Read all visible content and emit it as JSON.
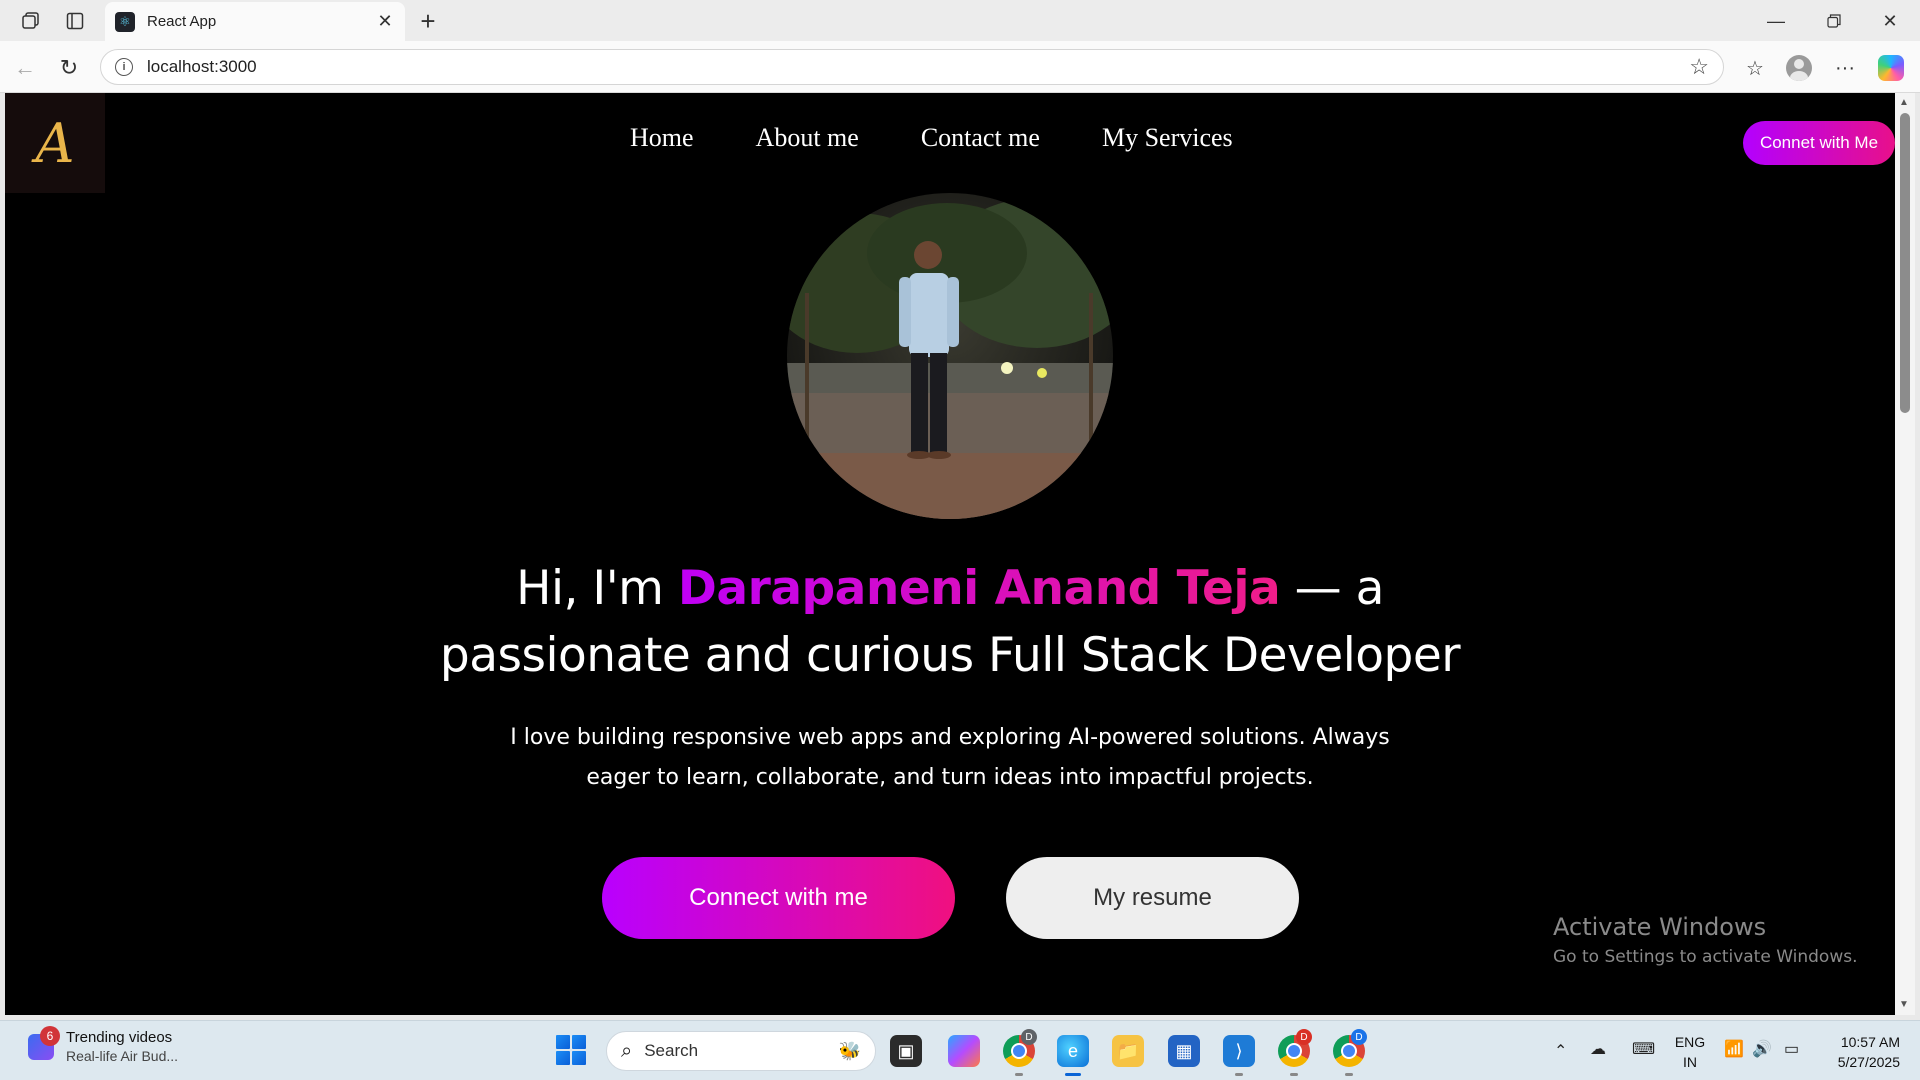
{
  "browser": {
    "tab_title": "React App",
    "url": "localhost:3000"
  },
  "site": {
    "logo_letter": "A",
    "nav": [
      "Home",
      "About me",
      "Contact me",
      "My Services"
    ],
    "header_button": "Connet with Me",
    "headline_prefix": "Hi, I'm ",
    "headline_name": "Darapaneni Anand Teja",
    "headline_suffix": " — a",
    "headline_line2": "passionate and curious Full Stack Developer",
    "subtitle_line1": "I love building responsive web apps and exploring AI-powered solutions. Always",
    "subtitle_line2": "eager to learn, collaborate, and turn ideas into impactful projects.",
    "primary_button": "Connect with me",
    "secondary_button": "My resume"
  },
  "watermark": {
    "line1": "Activate Windows",
    "line2": "Go to Settings to activate Windows."
  },
  "taskbar": {
    "news_badge": "6",
    "news_title": "Trending videos",
    "news_subtitle": "Real-life Air Bud...",
    "search_placeholder": "Search",
    "chrome_badge_1": "D",
    "chrome_badge_2": "D",
    "chrome_badge_3": "D",
    "lang_top": "ENG",
    "lang_bottom": "IN",
    "time": "10:57 AM",
    "date": "5/27/2025"
  },
  "colors": {
    "accent_gradient_start": "#b900ff",
    "accent_gradient_end": "#f0107f",
    "page_background": "#000000"
  },
  "icons": {
    "tab_favicon": "react-icon",
    "back": "back-arrow-icon",
    "refresh": "refresh-icon",
    "info": "info-icon",
    "favorite": "star-icon",
    "favorites_list": "favorites-icon",
    "profile": "profile-icon",
    "more": "more-icon",
    "copilot": "copilot-icon"
  }
}
